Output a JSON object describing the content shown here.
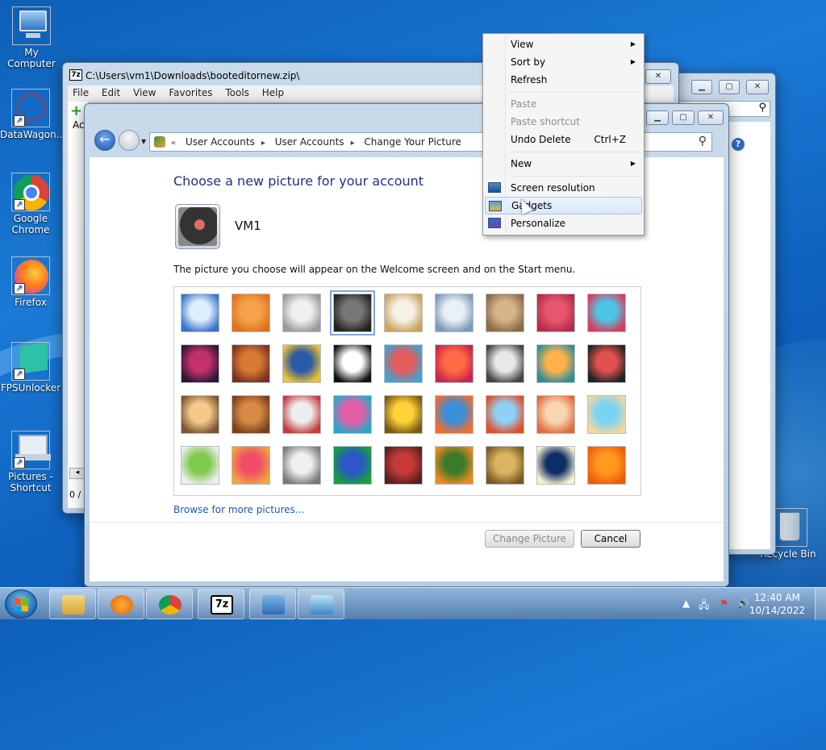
{
  "desktop": {
    "icons": [
      {
        "label": "My Computer",
        "icon": "computer-icon"
      },
      {
        "label": "DataWagon...",
        "icon": "datawagon-icon"
      },
      {
        "label": "Google Chrome",
        "icon": "chrome-icon"
      },
      {
        "label": "Firefox",
        "icon": "firefox-icon"
      },
      {
        "label": "FPSUnlocker",
        "icon": "fpsunlocker-icon"
      },
      {
        "label": "Pictures - Shortcut",
        "icon": "pictures-shortcut-icon"
      },
      {
        "label": "Recycle Bin",
        "icon": "recycle-bin-icon"
      }
    ]
  },
  "win7z": {
    "title": "C:\\Users\\vm1\\Downloads\\booteditornew.zip\\",
    "app_icon": "7z",
    "menu": [
      "File",
      "Edit",
      "View",
      "Favorites",
      "Tools",
      "Help"
    ],
    "toolbar_add": "Ac",
    "status": "0 / 8"
  },
  "control_panel": {
    "breadcrumbs": [
      "User Accounts",
      "User Accounts",
      "Change Your Picture"
    ],
    "heading": "Choose a new picture for your account",
    "account_name": "VM1",
    "description": "The picture you choose will appear on the Welcome screen and on the Start menu.",
    "pictures": [
      "rollercoaster",
      "starfish",
      "robot-toy",
      "turntable",
      "lucky-cat",
      "gyroscope",
      "kitten",
      "flower",
      "pinwheel",
      "ball",
      "fabric",
      "leaf",
      "border-collie",
      "crayons",
      "star-lantern",
      "metal-jacks",
      "stairs",
      "paper-crane",
      "guitar",
      "pomeranian",
      "tin-robot",
      "scarf",
      "sunflower",
      "fish",
      "balloon",
      "doll",
      "sailboat",
      "soccer-ball",
      "silk",
      "marbles",
      "window",
      "textile",
      "butterfly",
      "basket",
      "lighthouse",
      "daisy"
    ],
    "selected_index": 3,
    "browse_link": "Browse for more pictures...",
    "change_button": "Change Picture",
    "cancel_button": "Cancel"
  },
  "context_menu": {
    "items": [
      {
        "label": "View",
        "submenu": true
      },
      {
        "label": "Sort by",
        "submenu": true
      },
      {
        "label": "Refresh"
      },
      {
        "label": "Paste",
        "disabled": true
      },
      {
        "label": "Paste shortcut",
        "disabled": true
      },
      {
        "label": "Undo Delete",
        "shortcut": "Ctrl+Z"
      },
      {
        "label": "New",
        "submenu": true
      },
      {
        "label": "Screen resolution",
        "icon": "screen-resolution-icon"
      },
      {
        "label": "Gadgets",
        "icon": "gadgets-icon",
        "highlighted": true
      },
      {
        "label": "Personalize",
        "icon": "personalize-icon"
      }
    ]
  },
  "taskbar": {
    "pinned": [
      "file-explorer-icon",
      "media-player-icon",
      "chrome-icon",
      "7zip-icon",
      "control-panel-icon",
      "pictures-icon"
    ],
    "clock_time": "12:40 AM",
    "clock_date": "10/14/2022"
  }
}
